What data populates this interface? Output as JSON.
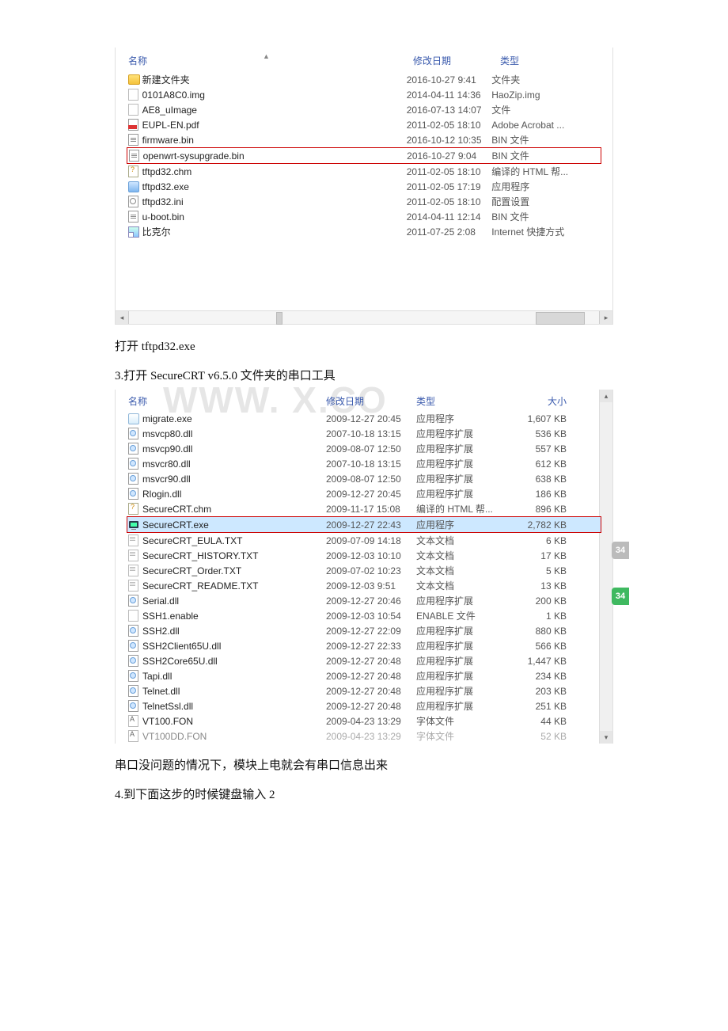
{
  "pane1": {
    "headers": {
      "name": "名称",
      "date": "修改日期",
      "type": "类型"
    },
    "rows": [
      {
        "icon": "folder",
        "name": "新建文件夹",
        "date": "2016-10-27 9:41",
        "type": "文件夹",
        "hl": false
      },
      {
        "icon": "file",
        "name": "0101A8C0.img",
        "date": "2014-04-11 14:36",
        "type": "HaoZip.img",
        "hl": false
      },
      {
        "icon": "file",
        "name": "AE8_uImage",
        "date": "2016-07-13 14:07",
        "type": "文件",
        "hl": false
      },
      {
        "icon": "pdf",
        "name": "EUPL-EN.pdf",
        "date": "2011-02-05 18:10",
        "type": "Adobe Acrobat ...",
        "hl": false
      },
      {
        "icon": "bin",
        "name": "firmware.bin",
        "date": "2016-10-12 10:35",
        "type": "BIN 文件",
        "hl": false
      },
      {
        "icon": "bin",
        "name": "openwrt-sysupgrade.bin",
        "date": "2016-10-27 9:04",
        "type": "BIN 文件",
        "hl": true
      },
      {
        "icon": "chm",
        "name": "tftpd32.chm",
        "date": "2011-02-05 18:10",
        "type": "编译的 HTML 帮...",
        "hl": false
      },
      {
        "icon": "exe",
        "name": "tftpd32.exe",
        "date": "2011-02-05 17:19",
        "type": "应用程序",
        "hl": false
      },
      {
        "icon": "ini",
        "name": "tftpd32.ini",
        "date": "2011-02-05 18:10",
        "type": "配置设置",
        "hl": false
      },
      {
        "icon": "bin",
        "name": "u-boot.bin",
        "date": "2014-04-11 12:14",
        "type": "BIN 文件",
        "hl": false
      },
      {
        "icon": "link",
        "name": "比克尔",
        "date": "2011-07-25 2:08",
        "type": "Internet 快捷方式",
        "hl": false
      }
    ]
  },
  "text1": "打开 tftpd32.exe",
  "text2": "3.打开 SecureCRT v6.5.0 文件夹的串口工具",
  "watermark": "WWW.      X.CO",
  "pane2": {
    "headers": {
      "name": "名称",
      "date": "修改日期",
      "type": "类型",
      "size": "大小"
    },
    "rows": [
      {
        "icon": "app",
        "name": "migrate.exe",
        "date": "2009-12-27 20:45",
        "type": "应用程序",
        "size": "1,607 KB"
      },
      {
        "icon": "dll",
        "name": "msvcp80.dll",
        "date": "2007-10-18 13:15",
        "type": "应用程序扩展",
        "size": "536 KB"
      },
      {
        "icon": "dll",
        "name": "msvcp90.dll",
        "date": "2009-08-07 12:50",
        "type": "应用程序扩展",
        "size": "557 KB"
      },
      {
        "icon": "dll",
        "name": "msvcr80.dll",
        "date": "2007-10-18 13:15",
        "type": "应用程序扩展",
        "size": "612 KB"
      },
      {
        "icon": "dll",
        "name": "msvcr90.dll",
        "date": "2009-08-07 12:50",
        "type": "应用程序扩展",
        "size": "638 KB"
      },
      {
        "icon": "dll",
        "name": "Rlogin.dll",
        "date": "2009-12-27 20:45",
        "type": "应用程序扩展",
        "size": "186 KB"
      },
      {
        "icon": "chm",
        "name": "SecureCRT.chm",
        "date": "2009-11-17 15:08",
        "type": "编译的 HTML 帮...",
        "size": "896 KB"
      },
      {
        "icon": "crt",
        "name": "SecureCRT.exe",
        "date": "2009-12-27 22:43",
        "type": "应用程序",
        "size": "2,782 KB",
        "hl": true
      },
      {
        "icon": "txt",
        "name": "SecureCRT_EULA.TXT",
        "date": "2009-07-09 14:18",
        "type": "文本文档",
        "size": "6 KB"
      },
      {
        "icon": "txt",
        "name": "SecureCRT_HISTORY.TXT",
        "date": "2009-12-03 10:10",
        "type": "文本文档",
        "size": "17 KB"
      },
      {
        "icon": "txt",
        "name": "SecureCRT_Order.TXT",
        "date": "2009-07-02 10:23",
        "type": "文本文档",
        "size": "5 KB"
      },
      {
        "icon": "txt",
        "name": "SecureCRT_README.TXT",
        "date": "2009-12-03 9:51",
        "type": "文本文档",
        "size": "13 KB"
      },
      {
        "icon": "dll",
        "name": "Serial.dll",
        "date": "2009-12-27 20:46",
        "type": "应用程序扩展",
        "size": "200 KB"
      },
      {
        "icon": "file",
        "name": "SSH1.enable",
        "date": "2009-12-03 10:54",
        "type": "ENABLE 文件",
        "size": "1 KB"
      },
      {
        "icon": "dll",
        "name": "SSH2.dll",
        "date": "2009-12-27 22:09",
        "type": "应用程序扩展",
        "size": "880 KB"
      },
      {
        "icon": "dll",
        "name": "SSH2Client65U.dll",
        "date": "2009-12-27 22:33",
        "type": "应用程序扩展",
        "size": "566 KB"
      },
      {
        "icon": "dll",
        "name": "SSH2Core65U.dll",
        "date": "2009-12-27 20:48",
        "type": "应用程序扩展",
        "size": "1,447 KB"
      },
      {
        "icon": "dll",
        "name": "Tapi.dll",
        "date": "2009-12-27 20:48",
        "type": "应用程序扩展",
        "size": "234 KB"
      },
      {
        "icon": "dll",
        "name": "Telnet.dll",
        "date": "2009-12-27 20:48",
        "type": "应用程序扩展",
        "size": "203 KB"
      },
      {
        "icon": "dll",
        "name": "TelnetSsl.dll",
        "date": "2009-12-27 20:48",
        "type": "应用程序扩展",
        "size": "251 KB"
      },
      {
        "icon": "fon",
        "name": "VT100.FON",
        "date": "2009-04-23 13:29",
        "type": "字体文件",
        "size": "44 KB"
      },
      {
        "icon": "fon",
        "name": "VT100DD.FON",
        "date": "2009-04-23 13:29",
        "type": "字体文件",
        "size": "52 KB",
        "dim": true
      }
    ]
  },
  "text3": "串口没问题的情况下，模块上电就会有串口信息出来",
  "text4": "4.到下面这步的时候键盘输入 2",
  "badges": {
    "b1": "34",
    "b2": "34"
  }
}
